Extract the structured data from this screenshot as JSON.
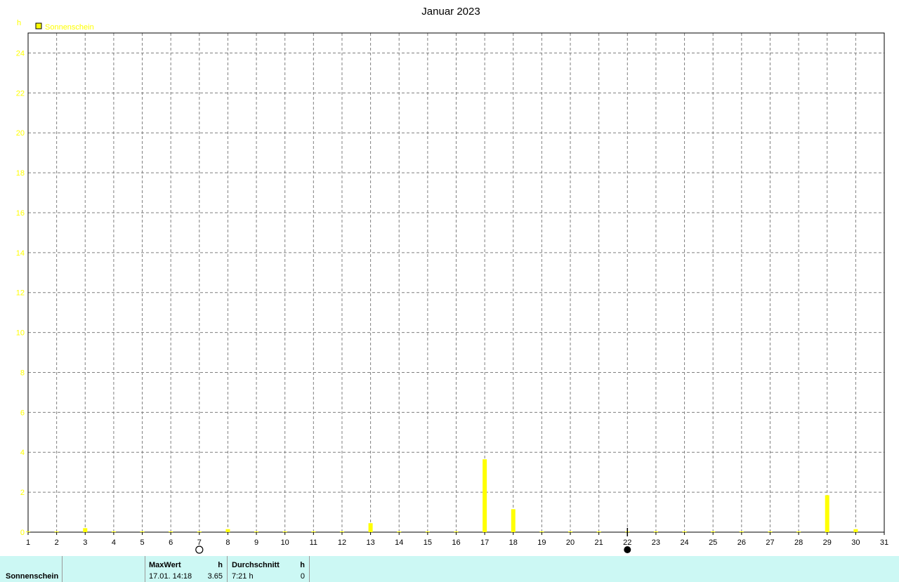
{
  "chart_data": {
    "type": "bar",
    "title": "Januar 2023",
    "ylabel": "h",
    "xlabel": "",
    "ylim": [
      0,
      25
    ],
    "xlim": [
      1,
      31
    ],
    "yticks": [
      0,
      2,
      4,
      6,
      8,
      10,
      12,
      14,
      16,
      18,
      20,
      22,
      24
    ],
    "categories": [
      "1",
      "2",
      "3",
      "4",
      "5",
      "6",
      "7",
      "8",
      "9",
      "10",
      "11",
      "12",
      "13",
      "14",
      "15",
      "16",
      "17",
      "18",
      "19",
      "20",
      "21",
      "22",
      "23",
      "24",
      "25",
      "26",
      "27",
      "28",
      "29",
      "30",
      "31"
    ],
    "series": [
      {
        "name": "Sonnenschein",
        "color": "#ffff00",
        "x": [
          1,
          2,
          3,
          4,
          5,
          6,
          7,
          8,
          9,
          10,
          11,
          12,
          13,
          14,
          15,
          16,
          17,
          18,
          19,
          20,
          21,
          22,
          23,
          24,
          25,
          26,
          27,
          28,
          29,
          30
        ],
        "values": [
          0.03,
          0.03,
          0.2,
          0.03,
          0.03,
          0.03,
          0.03,
          0.15,
          0.03,
          0.03,
          0.03,
          0.03,
          0.45,
          0.03,
          0.03,
          0.03,
          3.65,
          1.15,
          0.03,
          0.03,
          0.03,
          0.03,
          0.03,
          0.03,
          0.03,
          0.03,
          0.03,
          0.03,
          1.85,
          0.15
        ]
      }
    ],
    "grid": true,
    "legend": "top-left",
    "moon_phases": [
      {
        "day": 7,
        "phase": "full-moon"
      },
      {
        "day": 22,
        "phase": "new-moon"
      }
    ]
  },
  "footer": {
    "series_label": "Sonnenschein",
    "max_header": "MaxWert",
    "max_unit": "h",
    "max_datetime": "17.01.  14:18",
    "max_value": "3.65",
    "avg_header": "Durchschnitt",
    "avg_unit": "h",
    "avg_value": "7:21 h",
    "avg_extra": "0"
  }
}
